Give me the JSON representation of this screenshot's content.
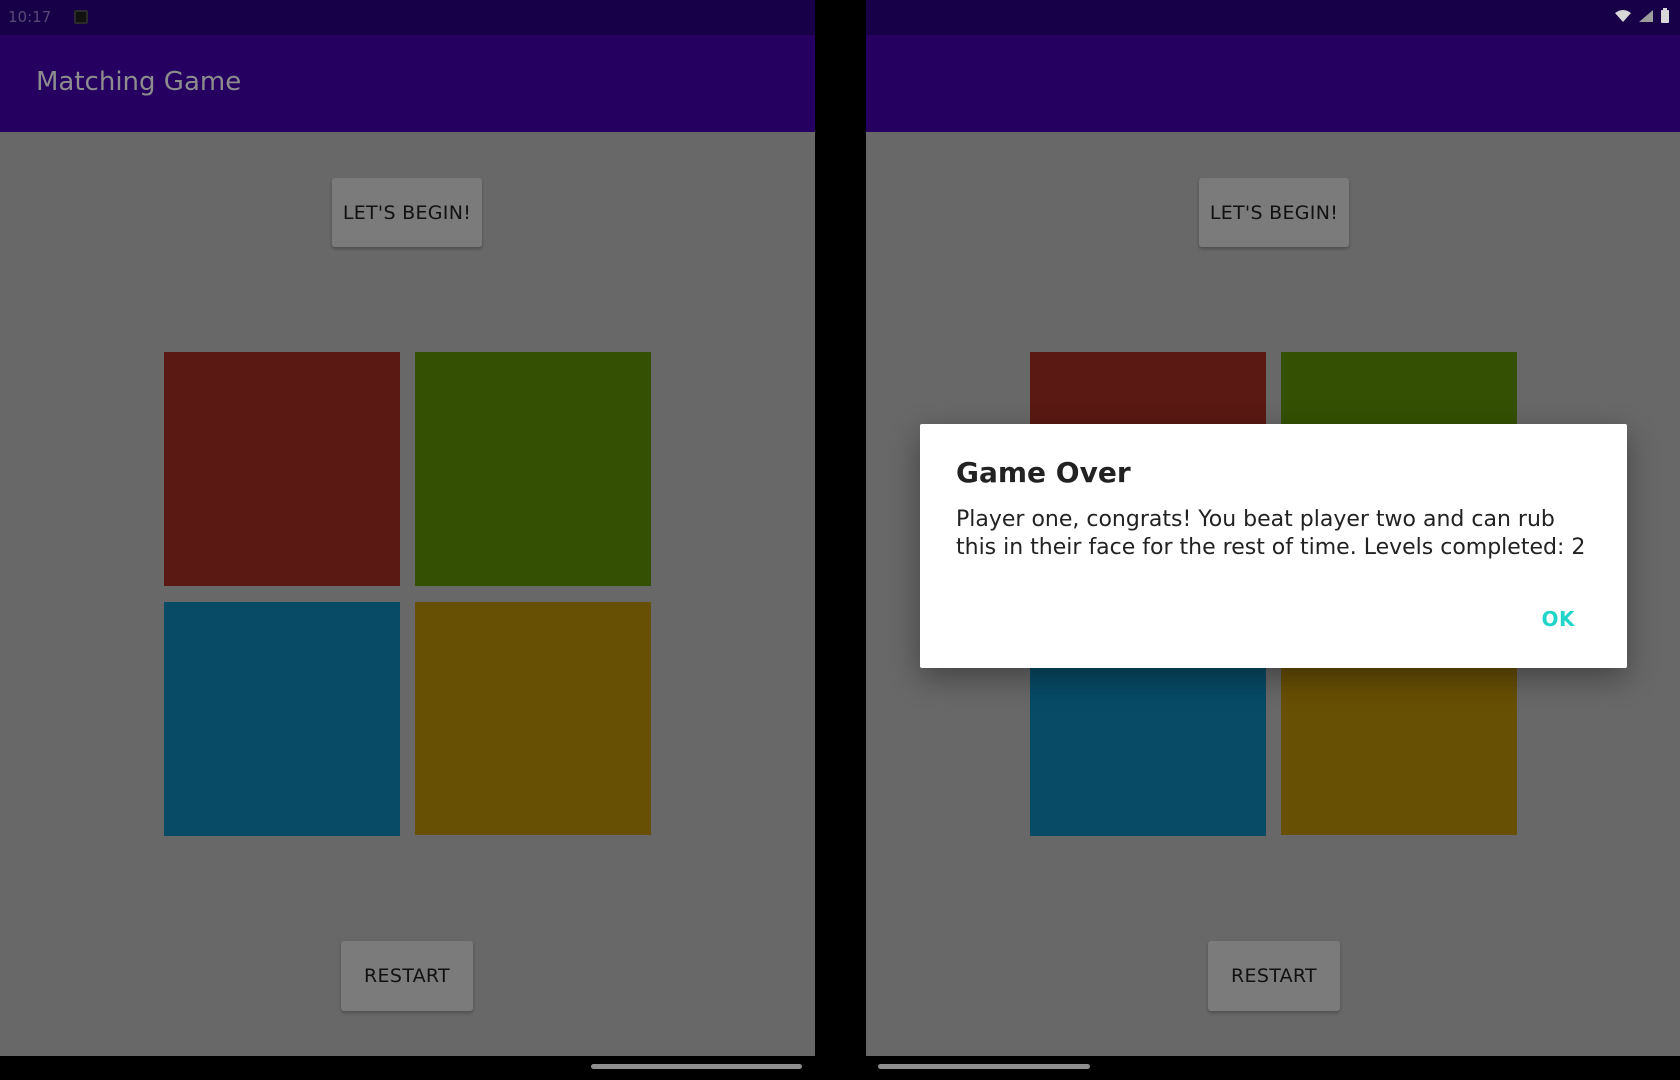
{
  "status_bar": {
    "time": "10:17"
  },
  "left_screen": {
    "app_title": "Matching Game",
    "begin_button": "LET'S BEGIN!",
    "restart_button": "RESTART",
    "tiles": [
      {
        "name": "red",
        "color": "#5a1912"
      },
      {
        "name": "green",
        "color": "#345103"
      },
      {
        "name": "blue",
        "color": "#074b66"
      },
      {
        "name": "yellow",
        "color": "#674f04"
      }
    ]
  },
  "right_screen": {
    "begin_button": "LET'S BEGIN!",
    "restart_button": "RESTART"
  },
  "dialog": {
    "title": "Game Over",
    "message": "Player one, congrats! You beat player two and can rub this in their face for the rest of time. Levels completed: 2",
    "ok_label": "OK"
  },
  "colors": {
    "app_bar": "#250061",
    "status_bar": "#180049",
    "overlay_background": "#686868",
    "accent": "#22d5ca"
  },
  "icons": [
    "notification-icon",
    "wifi-icon",
    "signal-icon",
    "battery-icon"
  ]
}
